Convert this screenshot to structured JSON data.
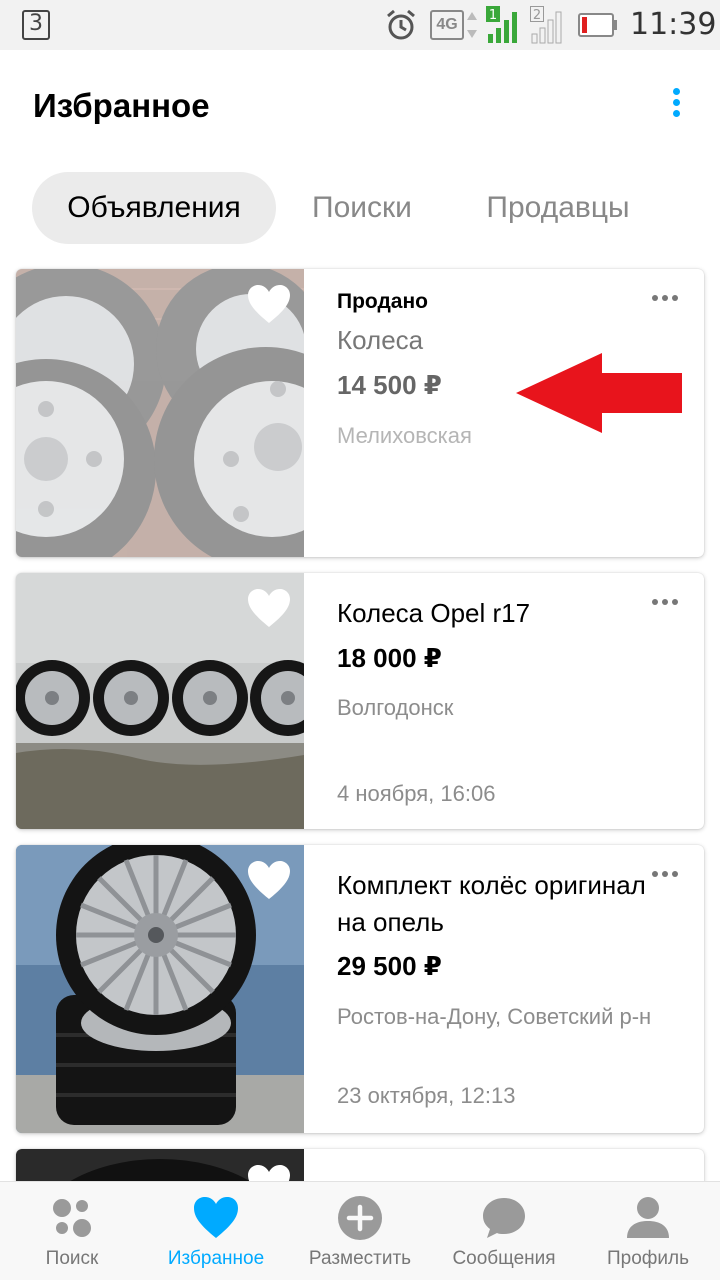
{
  "status_bar": {
    "notification_badge": "3",
    "network_label": "4G",
    "sim1_label": "1",
    "sim2_label": "2",
    "time": "11:39",
    "icons": [
      "notification-icon",
      "alarm-icon",
      "4g-icon",
      "signal-sim1-icon",
      "signal-sim2-icon",
      "battery-low-icon"
    ]
  },
  "header": {
    "title": "Избранное",
    "menu_icon": "kebab-menu-icon"
  },
  "tabs": [
    {
      "label": "Объявления",
      "active": true
    },
    {
      "label": "Поиски",
      "active": false
    },
    {
      "label": "Продавцы",
      "active": false
    }
  ],
  "listings": [
    {
      "status": "Продано",
      "title": "Колеса",
      "price": "14 500 ₽",
      "location": "Мелиховская",
      "date": "",
      "favorite": true
    },
    {
      "status": "",
      "title": "Колеса Opel r17",
      "price": "18 000 ₽",
      "location": "Волгодонск",
      "date": "4 ноября, 16:06",
      "favorite": true
    },
    {
      "status": "",
      "title": "Комплект колёс оригинал на опель",
      "price": "29 500 ₽",
      "location": "Ростов-на-Дону, Советский р-н",
      "date": "23 октября, 12:13",
      "favorite": true
    }
  ],
  "bottom_nav": [
    {
      "label": "Поиск",
      "icon": "search-tiles-icon",
      "active": false
    },
    {
      "label": "Избранное",
      "icon": "heart-icon",
      "active": true
    },
    {
      "label": "Разместить",
      "icon": "plus-circle-icon",
      "active": false
    },
    {
      "label": "Сообщения",
      "icon": "chat-bubble-icon",
      "active": false
    },
    {
      "label": "Профиль",
      "icon": "person-icon",
      "active": false
    }
  ],
  "colors": {
    "accent": "#00aaff",
    "annotation_arrow": "#e8141c",
    "muted_text": "#8c8c8c",
    "active_tab_bg": "#ebebeb"
  }
}
